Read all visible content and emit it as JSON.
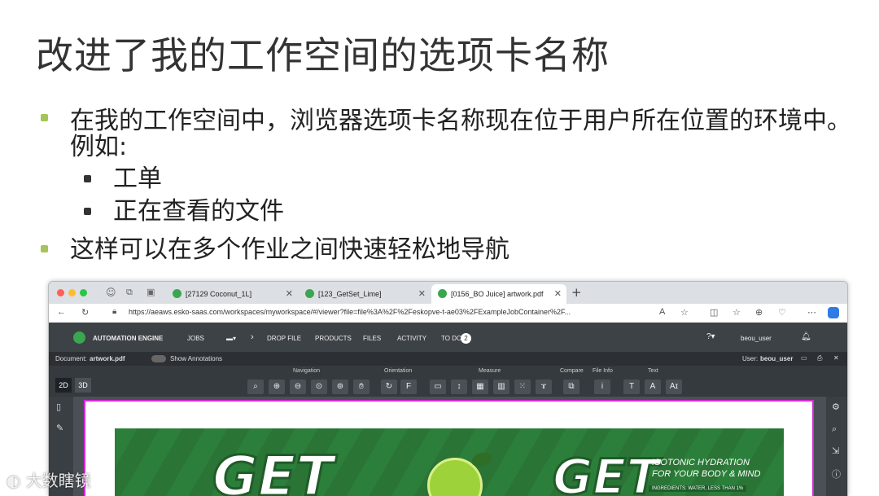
{
  "slide": {
    "title": "改进了我的工作空间的选项卡名称",
    "bullets": [
      {
        "text": "在我的工作空间中，浏览器选项卡名称现在位于用户所在位置的环境中。",
        "text_cont": "例如:"
      },
      {
        "text": "这样可以在多个作业之间快速轻松地导航"
      }
    ],
    "sub_bullets": [
      "工单",
      "正在查看的文件"
    ]
  },
  "browser": {
    "tabs": [
      {
        "label": "[27129 Coconut_1L]"
      },
      {
        "label": "[123_GetSet_Lime]"
      },
      {
        "label": "[0156_BO Juice] artwork.pdf"
      }
    ],
    "url": "https://aeaws.esko-saas.com/workspaces/myworkspace/#/viewer?file=file%3A%2F%2Feskopve-t-ae03%2FExampleJobContainer%2F..."
  },
  "app": {
    "brand": "AUTOMATION ENGINE",
    "nav": [
      "JOBS",
      "DROP FILE",
      "PRODUCTS",
      "FILES",
      "ACTIVITY",
      "TO DO"
    ],
    "todo_count": "2",
    "user_menu": "beou_user",
    "document_label": "Document:",
    "document_name": "artwork.pdf",
    "show_annotations": "Show Annotations",
    "user_label": "User:",
    "user_name": "beou_user",
    "toolbar_groups": [
      "Navigation",
      "Orientation",
      "Measure",
      "Compare",
      "File Info",
      "Text"
    ],
    "view_modes": [
      "2D",
      "3D"
    ]
  },
  "artwork": {
    "brand_text": "GET",
    "tagline_1": "ISOTONIC HYDRATION",
    "tagline_2": "FOR YOUR BODY & MIND",
    "ingredients": "INGREDIENTS: WATER, LESS THAN 1%"
  },
  "watermark": {
    "text": "大数瞎镜"
  },
  "colors": {
    "bullet": "#a7c35b",
    "app_bar": "#3d4247",
    "accent_green": "#3aa650",
    "canvas_border": "#d62ad6"
  }
}
